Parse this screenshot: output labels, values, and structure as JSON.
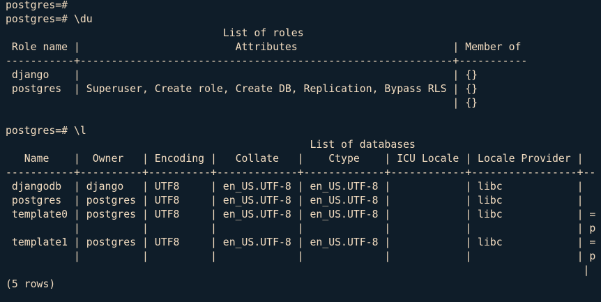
{
  "theme": {
    "background": "#0f1d29",
    "foreground": "#f2dcc0"
  },
  "terminal": {
    "lines": [
      "postgres=#",
      "postgres=# \\du",
      "                                   List of roles",
      " Role name |                         Attributes                         | Member of",
      "-----------+------------------------------------------------------------+-----------",
      " django    |                                                            | {}",
      " postgres  | Superuser, Create role, Create DB, Replication, Bypass RLS | {}",
      "                                                                        | {}",
      "",
      "postgres=# \\l",
      "                                                 List of databases",
      "   Name    |  Owner   | Encoding |   Collate   |    Ctype    | ICU Locale | Locale Provider | ",
      "-----------+----------+----------+-------------+-------------+------------+-----------------+--",
      " djangodb  | django   | UTF8     | en_US.UTF-8 | en_US.UTF-8 |            | libc            | ",
      " postgres  | postgres | UTF8     | en_US.UTF-8 | en_US.UTF-8 |            | libc            | ",
      " template0 | postgres | UTF8     | en_US.UTF-8 | en_US.UTF-8 |            | libc            | =",
      "           |          |          |             |             |            |                 | p",
      " template1 | postgres | UTF8     | en_US.UTF-8 | en_US.UTF-8 |            | libc            | =",
      "           |          |          |             |             |            |                 | p",
      "                                                                                             |",
      "(5 rows)"
    ]
  }
}
